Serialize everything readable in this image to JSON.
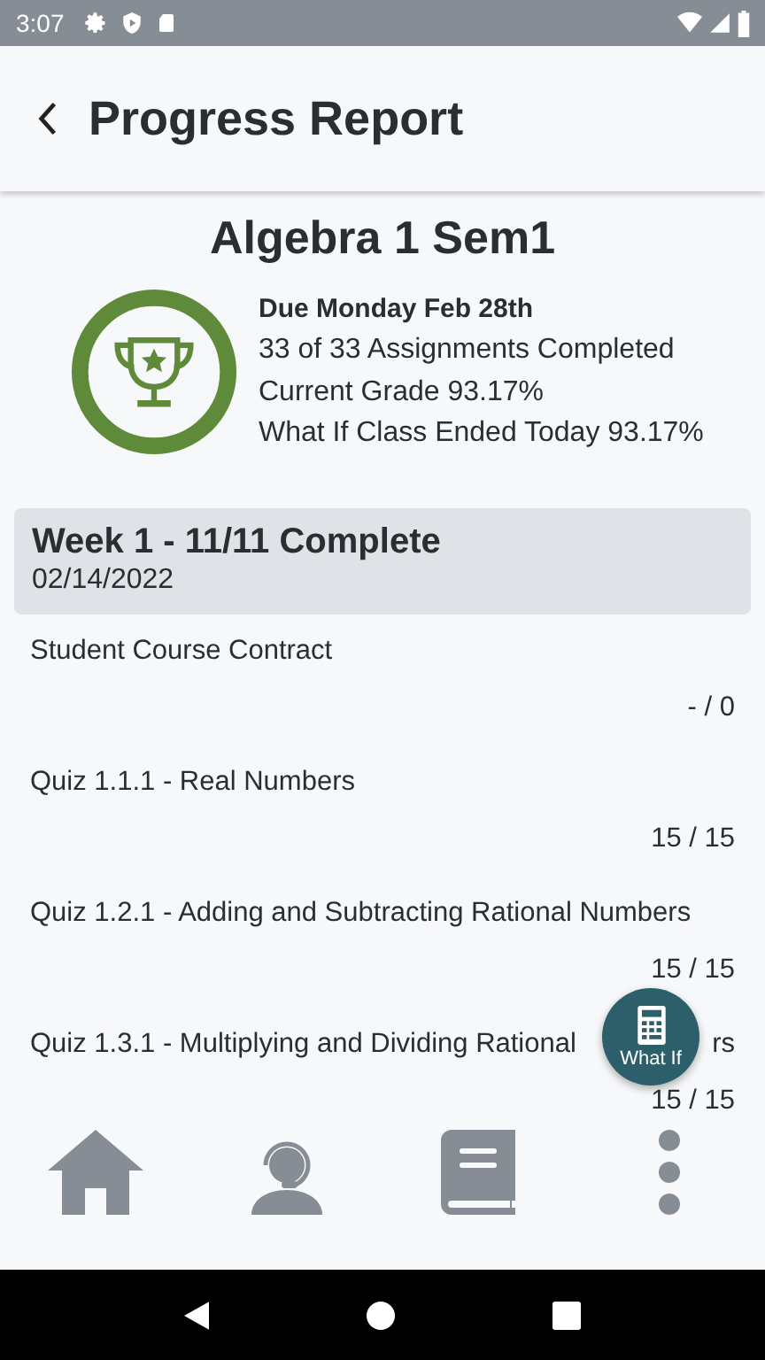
{
  "status_bar": {
    "time": "3:07"
  },
  "header": {
    "title": "Progress Report"
  },
  "course": {
    "title": "Algebra 1 Sem1",
    "due": "Due Monday Feb 28th",
    "completed": "33 of 33 Assignments Completed",
    "current_grade": "Current Grade 93.17%",
    "what_if": "What If Class Ended Today 93.17%"
  },
  "week": {
    "title": "Week 1 - 11/11 Complete",
    "date": "02/14/2022"
  },
  "assignments": [
    {
      "name": "Student Course Contract",
      "score": "- / 0"
    },
    {
      "name": "Quiz 1.1.1 - Real Numbers",
      "score": "15 / 15"
    },
    {
      "name": "Quiz 1.2.1 - Adding and Subtracting Rational Numbers",
      "score": "15 / 15"
    },
    {
      "name": "Quiz 1.3.1 - Multiplying and Dividing Rational",
      "name_tail": "rs",
      "score": "15 / 15"
    }
  ],
  "fab": {
    "label": "What If"
  },
  "bottom_nav": [
    {
      "kind": "home"
    },
    {
      "kind": "support"
    },
    {
      "kind": "book"
    },
    {
      "kind": "more"
    }
  ]
}
